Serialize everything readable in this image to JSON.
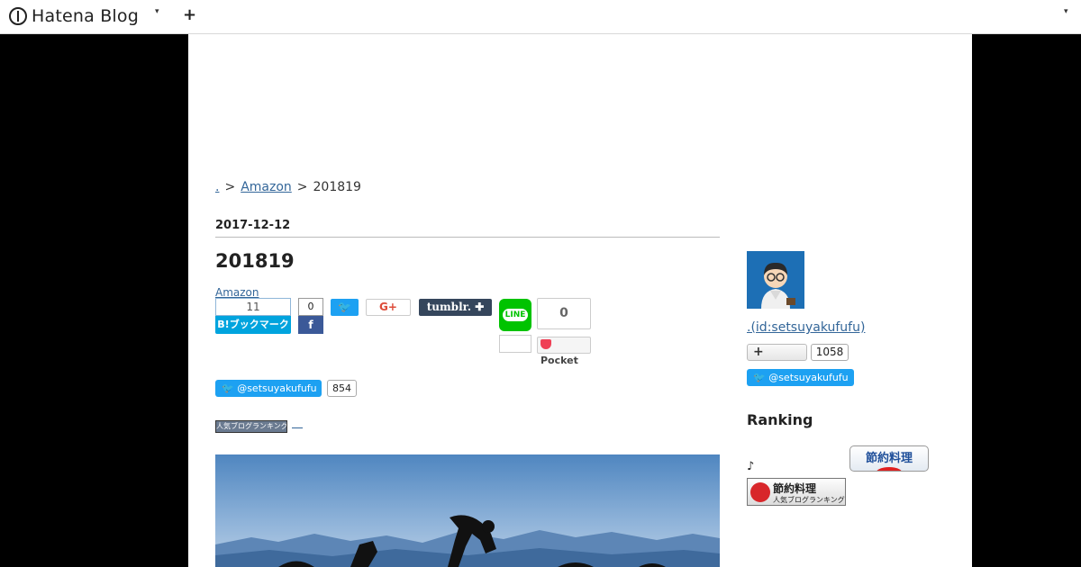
{
  "header": {
    "logo_text": "Hatena Blog",
    "caret": "▾",
    "plus": "+"
  },
  "breadcrumb": {
    "root": ".",
    "sep": ">",
    "category": "Amazon",
    "current": "201819"
  },
  "entry": {
    "date": "2017-12-12",
    "title": "201819",
    "category_link": "Amazon",
    "hatena_bookmark_count": "11",
    "hatena_bookmark_label": "B!ブックマーク",
    "facebook_count": "0",
    "facebook_label": "f",
    "twitter_label": "🐦",
    "googleplus_label": "G+",
    "tumblr_label": "tumblr. ✚",
    "line_label": "LINE",
    "pocket_count": "0",
    "pocket_label": "Pocket",
    "follow_label": "🐦 @setsuyakufufu",
    "follow_count": "854",
    "ranking_banner": "人気ブログランキング"
  },
  "sidebar": {
    "profile_link": ".(id:setsuyakufufu)",
    "follow_label": "+",
    "follow_count": "1058",
    "twitter_follow_label": "🐦 @setsuyakufufu",
    "ranking_heading": "Ranking",
    "note": "♪",
    "setsuyaku_button": "節約料理",
    "banner_title": "節約料理",
    "banner_sub": "人気ブログランキング"
  },
  "colors": {
    "link": "#336699",
    "hatena_blue": "#00a4de",
    "twitter_blue": "#1da1f2",
    "facebook_blue": "#3b5998",
    "tumblr_navy": "#35465c",
    "line_green": "#00c300",
    "pocket_red": "#ef4056"
  }
}
